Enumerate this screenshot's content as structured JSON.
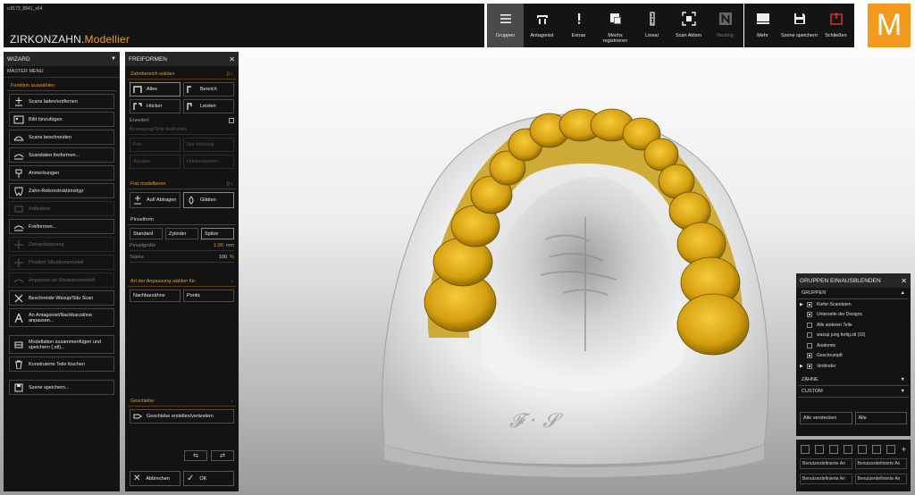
{
  "build": "v.8173_8841_x64",
  "brand": {
    "part1": "ZIRKONZAHN.",
    "part2": "Modellier"
  },
  "toolbar": [
    {
      "label": "Gruppen",
      "icon": "hamburger-icon",
      "active": true
    },
    {
      "label": "Antagonist",
      "icon": "antagonist-icon"
    },
    {
      "label": "Extras",
      "icon": "exclamation-icon"
    },
    {
      "label": "Meshs registrieren",
      "icon": "mesh-register-icon"
    },
    {
      "label": "Lineal",
      "icon": "ruler-icon"
    },
    {
      "label": "Scan Aktion",
      "icon": "scan-action-icon"
    },
    {
      "label": "Nesting",
      "icon": "nesting-icon",
      "dim": true
    }
  ],
  "toolbar2": [
    {
      "label": "Mehr",
      "icon": "more-icon"
    },
    {
      "label": "Szene speichern",
      "icon": "save-icon"
    },
    {
      "label": "Schließen",
      "icon": "power-icon"
    }
  ],
  "logo": "M",
  "wizard": {
    "title": "WIZARD",
    "master": "MASTER MENU",
    "section": "Funktion auswählen",
    "items": [
      {
        "label": "Scans laden/entfernen"
      },
      {
        "label": "Bild hinzufügen"
      },
      {
        "label": "Scans beschneiden"
      },
      {
        "label": "Scandaten freiformen..."
      },
      {
        "label": "Anmerkungen"
      },
      {
        "label": "Zahn-Rekonstruktionstyp"
      },
      {
        "label": "Artikulator",
        "dim": true
      },
      {
        "label": "Freiformen..."
      },
      {
        "label": "Zahnplatzierung",
        "dim": true
      },
      {
        "label": "Position Situationsmodell",
        "dim": true
      },
      {
        "label": "Anpassen an Situationsmodell",
        "dim": true
      },
      {
        "label": "Beschneide Waxup/Situ Scan"
      },
      {
        "label": "An Antagonist/Nachbarzähne anpassen...",
        "tall": true
      },
      {
        "label": "Modellation zusammenfügen und speichern (.stl)...",
        "tall": true
      },
      {
        "label": "Konstruierte Teile löschen"
      },
      {
        "label": "Szene speichern..."
      }
    ]
  },
  "frei": {
    "title": "FREIFORMEN",
    "sec1": "Zahnbereich wählen",
    "alles": "Alles",
    "bereich": "Bereich",
    "hoecker": "Höcker",
    "leisten": "Leisten",
    "erweitert": "Erweitert",
    "bewegung": "Bewegung/Teile festhalten",
    "frei": "Frei",
    "nur_okklusal": "Nur okklusal",
    "aquator": "Äquator",
    "hoeckerspitzen": "Höckerspitzen",
    "sec2": "Frei modellieren",
    "auf_abtragen": "Auf/ Abtragen",
    "glaetten": "Glätten",
    "pinselform": "Pinselform",
    "standard": "Standard",
    "zylinder": "Zylinder",
    "spitze": "Spitze",
    "pinselgroesse_label": "Pinselgröße",
    "pinselgroesse_value": "1.00",
    "pinselgroesse_unit": "mm",
    "staerke_label": "Stärke",
    "staerke_value": "100",
    "staerke_unit": "%",
    "sec3": "Art der Anpassung wählen für:",
    "nachbarzaehne": "Nachbarzähne",
    "pontic": "Pontic",
    "sec4": "Geschiebe",
    "geschiebe": "Geschiebe erstellen/verändern",
    "abbrechen": "Abbrechen",
    "ok": "OK"
  },
  "groups": {
    "title": "GRUPPEN EIN/AUSBLENDEN",
    "sub1": "GRUPPEN",
    "items": [
      {
        "label": "Kiefer-Scandaten",
        "arrow": true,
        "checked": true
      },
      {
        "label": "Unterseite der Designs",
        "checked": true
      },
      {
        "label": "Alle anderen Teile",
        "checked": false
      },
      {
        "label": "waxup jung fertig.stl (16)",
        "checked": false
      },
      {
        "label": "Anatomie",
        "checked": false
      },
      {
        "label": "Geschrumpft",
        "checked": true
      },
      {
        "label": "Verbinder",
        "arrow": true,
        "checked": true
      }
    ],
    "sub2": "ZÄHNE",
    "sub3": "CUSTOM",
    "alle_verstecken": "Alle verstecken",
    "alle": "Alle"
  },
  "custom": {
    "buttons": [
      "Benutzerdefinierte An",
      "Benutzerdefinierte An",
      "Benutzerdefinierte An",
      "Benutzerdefinierte An"
    ]
  },
  "colors": {
    "accent": "#f39a1e",
    "panel": "#131313",
    "teeth": "#d9a514",
    "model": "#e8e8e8"
  }
}
